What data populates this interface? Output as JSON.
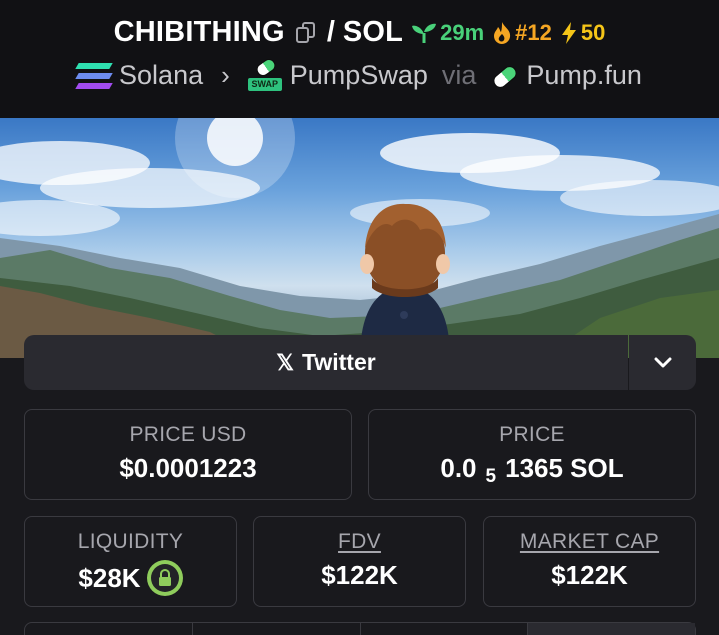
{
  "header": {
    "token_symbol": "CHIBITHING",
    "separator": "/",
    "quote_symbol": "SOL",
    "age": "29m",
    "rank": "#12",
    "boosts": "50",
    "chain": "Solana",
    "dex": "PumpSwap",
    "via_label": "via",
    "launchpad": "Pump.fun",
    "dex_logo_tag": "SWAP"
  },
  "socials": {
    "twitter_label": "Twitter",
    "x_glyph": "𝕏"
  },
  "stats": {
    "price_usd_label": "PRICE USD",
    "price_usd_value": "$0.0001223",
    "price_label": "PRICE",
    "price_prefix": "0.0",
    "price_zero_count": "5",
    "price_suffix": "1365 SOL",
    "liquidity_label": "LIQUIDITY",
    "liquidity_value": "$28K",
    "fdv_label": "FDV",
    "fdv_value": "$122K",
    "mcap_label": "MARKET CAP",
    "mcap_value": "$122K"
  },
  "colors": {
    "age_green": "#49d17a",
    "rank_orange": "#f5a623",
    "boost_yellow": "#f5c518",
    "lock_green": "#8fcc5c"
  },
  "icons": [
    "copy-icon",
    "seedling-icon",
    "flame-icon",
    "lightning-icon",
    "solana-logo",
    "pumpswap-logo",
    "pumpfun-logo",
    "x-logo-icon",
    "chevron-down-icon",
    "lock-icon"
  ]
}
